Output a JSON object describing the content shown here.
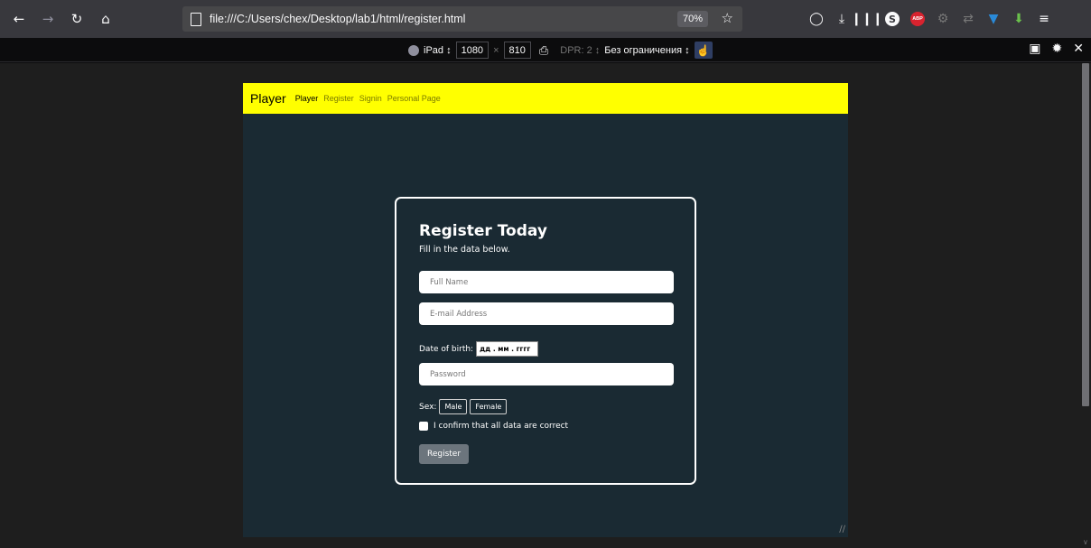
{
  "browser": {
    "url": "file:///C:/Users/chex/Desktop/lab1/html/register.html",
    "zoom": "70%"
  },
  "responsive": {
    "device": "iPad ↕",
    "width": "1080",
    "times": "×",
    "height": "810",
    "dpr": "DPR: 2 ↕",
    "throttle": "Без ограничения ↕"
  },
  "nav": {
    "brand": "Player",
    "links": [
      "Player",
      "Register",
      "Signin",
      "Personal Page"
    ]
  },
  "form": {
    "title": "Register Today",
    "subtitle": "Fill in the data below.",
    "full_name_placeholder": "Full Name",
    "email_placeholder": "E-mail Address",
    "dob_label": "Date of birth:",
    "dob_placeholder": "дд . мм . гггг",
    "password_placeholder": "Password",
    "sex_label": "Sex:",
    "sex_options": [
      "Male",
      "Female"
    ],
    "confirm_label": "I confirm that all data are correct",
    "submit_label": "Register"
  }
}
